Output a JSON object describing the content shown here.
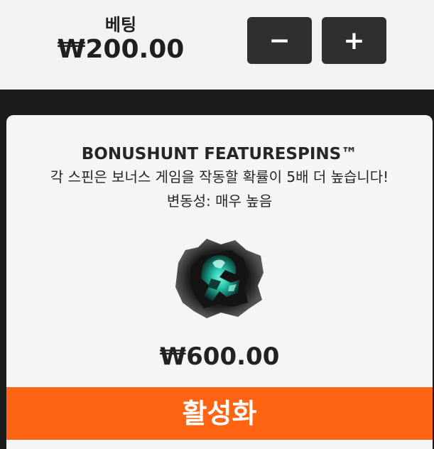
{
  "bet": {
    "label": "베팅",
    "amount": "₩200.00",
    "decrease_label": "−",
    "increase_label": "+"
  },
  "feature": {
    "title": "BONUSHUNT FEATURESPINS™",
    "description": "각 스핀은 보너스 게임을 작동할 확률이 5배 더 높습니다!",
    "volatility": "변동성: 매우 높음",
    "image_icon": "rune-stone-icon",
    "price": "₩600.00",
    "activate_label": "활성화"
  },
  "colors": {
    "accent": "#ff6413",
    "button_dark": "#2f2f2f",
    "rune_glow": "#2fd6b8"
  }
}
